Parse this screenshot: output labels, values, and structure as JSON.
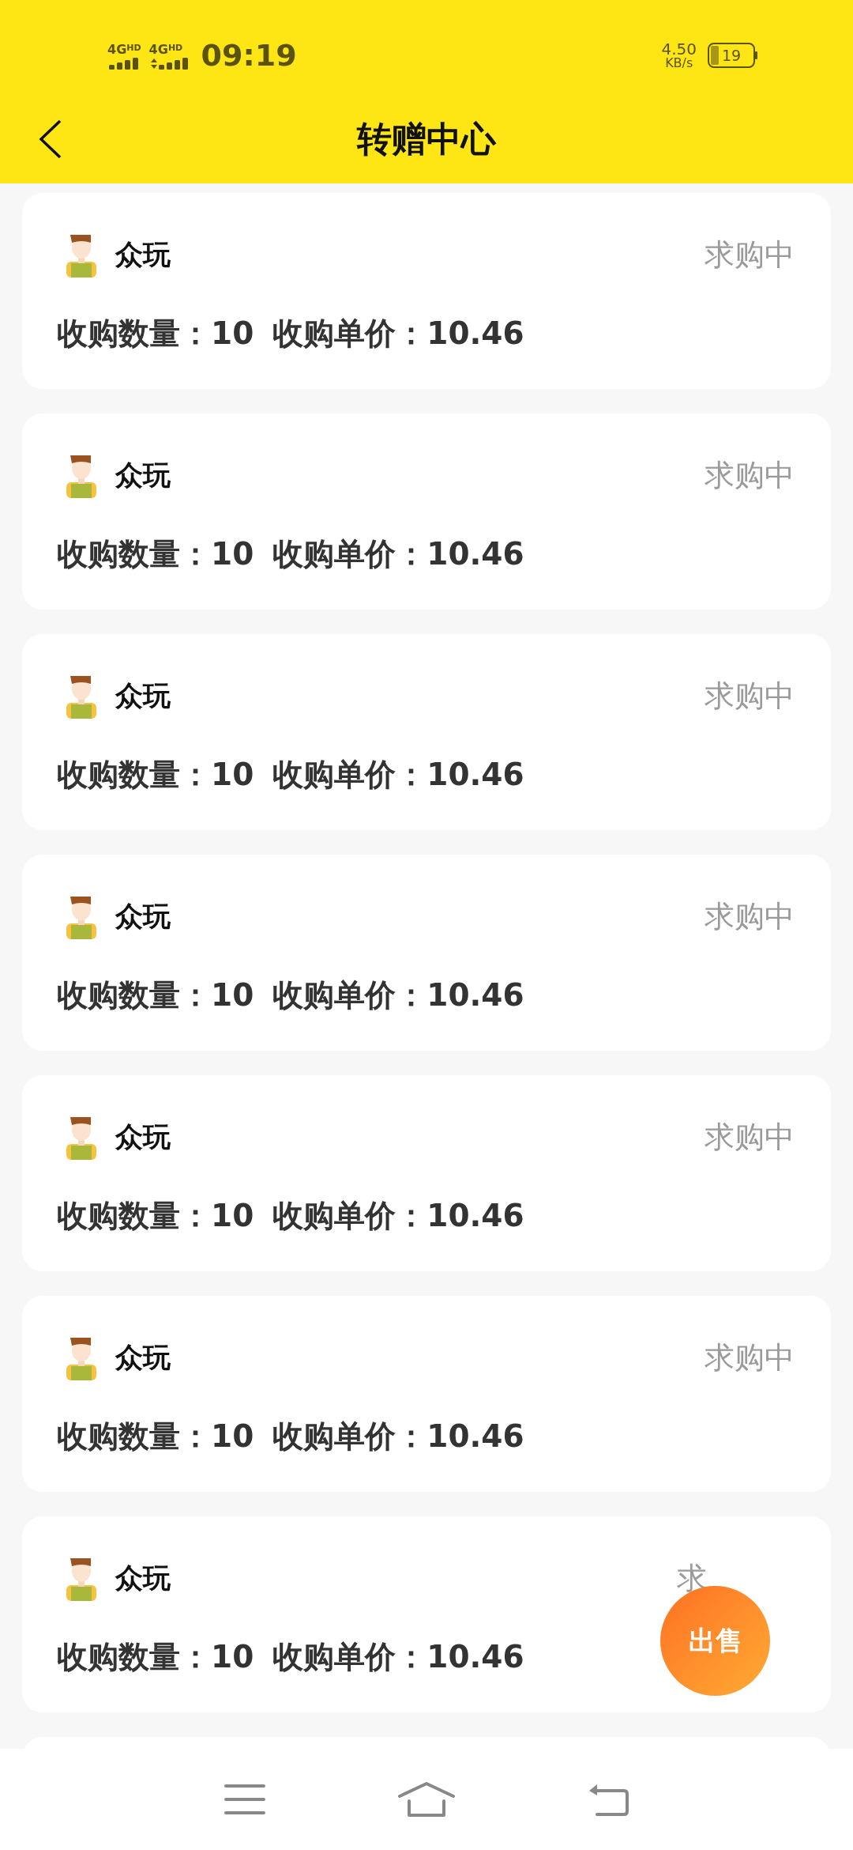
{
  "status_bar": {
    "sim_cards": [
      {
        "network": "4G",
        "tag": "HD"
      },
      {
        "network": "4G",
        "tag": "HD"
      }
    ],
    "time": "09:19",
    "speed_value": "4.50",
    "speed_unit": "KB/s",
    "battery": "19"
  },
  "header": {
    "title": "转赠中心"
  },
  "orders": [
    {
      "name": "众玩",
      "status": "求购中",
      "quantity": "收购数量：10",
      "unit_price": "收购单价：10.46"
    },
    {
      "name": "众玩",
      "status": "求购中",
      "quantity": "收购数量：10",
      "unit_price": "收购单价：10.46"
    },
    {
      "name": "众玩",
      "status": "求购中",
      "quantity": "收购数量：10",
      "unit_price": "收购单价：10.46"
    },
    {
      "name": "众玩",
      "status": "求购中",
      "quantity": "收购数量：10",
      "unit_price": "收购单价：10.46"
    },
    {
      "name": "众玩",
      "status": "求购中",
      "quantity": "收购数量：10",
      "unit_price": "收购单价：10.46"
    },
    {
      "name": "众玩",
      "status": "求购中",
      "quantity": "收购数量：10",
      "unit_price": "收购单价：10.46"
    },
    {
      "name": "众玩",
      "status": "求",
      "quantity": "收购数量：10",
      "unit_price": "收购单价：10.46"
    }
  ],
  "sell_button": "出售"
}
